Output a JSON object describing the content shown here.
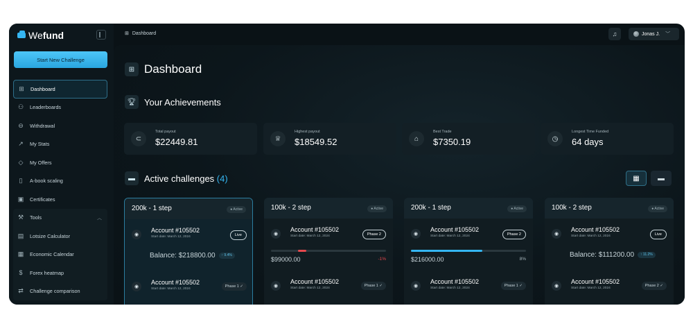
{
  "brand": {
    "logo_we": "We",
    "logo_fund": "fund"
  },
  "sidebar": {
    "start_button": "Start New Challenge",
    "items": [
      {
        "label": "Dashboard",
        "icon": "grid-icon",
        "glyph": "⊞"
      },
      {
        "label": "Leaderboards",
        "icon": "users-icon",
        "glyph": "⚇"
      },
      {
        "label": "Withdrawal",
        "icon": "coins-icon",
        "glyph": "⊖"
      },
      {
        "label": "My Stats",
        "icon": "chart-line-icon",
        "glyph": "↗"
      },
      {
        "label": "My Offers",
        "icon": "tag-icon",
        "glyph": "◇"
      },
      {
        "label": "A-book scaling",
        "icon": "book-icon",
        "glyph": "▯"
      },
      {
        "label": "Certificates",
        "icon": "certificate-icon",
        "glyph": "▣"
      }
    ],
    "tools": {
      "label": "Tools",
      "items": [
        {
          "label": "Lotsize Calculator",
          "icon": "calculator-icon",
          "glyph": "▤"
        },
        {
          "label": "Economic Calendar",
          "icon": "calendar-icon",
          "glyph": "▦"
        },
        {
          "label": "Forex heatmap",
          "icon": "dollar-icon",
          "glyph": "$"
        },
        {
          "label": "Challenge comparison",
          "icon": "compare-icon",
          "glyph": "⇄"
        }
      ]
    }
  },
  "topbar": {
    "breadcrumb": "Dashboard",
    "user_name": "Jonas J."
  },
  "main": {
    "title": "Dashboard",
    "achievements_title": "Your Achievements",
    "achievements": [
      {
        "label": "Total payout",
        "value": "$22449.81",
        "icon": "hand-coins-icon",
        "glyph": "⊂"
      },
      {
        "label": "Highest payout",
        "value": "$18549.52",
        "icon": "trophy-icon",
        "glyph": "♕"
      },
      {
        "label": "Best Trade",
        "value": "$7350.19",
        "icon": "rocket-icon",
        "glyph": "⌂"
      },
      {
        "label": "Longest Time Funded",
        "value": "64 days",
        "icon": "timer-icon",
        "glyph": "◷"
      }
    ],
    "challenges_title": "Active challenges",
    "challenges_count": "(4)",
    "challenges": [
      {
        "title": "200k - 1 step",
        "badge": "● Active",
        "account": "Account #105502",
        "start": "Start date: March 12, 2024",
        "status": "Live",
        "balance": "Balance: $218800.00",
        "change": "↑ 9.4%",
        "account2": "Account #105502",
        "start2": "Start date: March 12, 2024",
        "status2": "Phase 1 ✓"
      },
      {
        "title": "100k - 2 step",
        "badge": "● Active",
        "account": "Account #105502",
        "start": "Start date: March 12, 2024",
        "status": "Phase 2",
        "amount": "$99000.00",
        "pct": "-1%",
        "progress": 0.07,
        "account2": "Account #105502",
        "start2": "Start date: March 12, 2024",
        "status2": "Phase 1 ✓"
      },
      {
        "title": "200k - 1 step",
        "badge": "● Active",
        "account": "Account #105502",
        "start": "Start date: March 12, 2024",
        "status": "Phase 2",
        "amount": "$216000.00",
        "pct": "8%",
        "progress": 0.62,
        "account2": "Account #105502",
        "start2": "Start date: March 12, 2024",
        "status2": "Phase 1 ✓"
      },
      {
        "title": "100k - 2 step",
        "badge": "● Active",
        "account": "Account #105502",
        "start": "Start date: March 12, 2024",
        "status": "Live",
        "balance": "Balance: $111200.00",
        "change": "↑ 11.2%",
        "account2": "Account #105502",
        "start2": "Start date: March 12, 2024",
        "status2": "Phase 2 ✓"
      }
    ]
  },
  "colors": {
    "accent": "#35b6f2",
    "negative": "#e5484d",
    "positive": "#35b6f2"
  }
}
